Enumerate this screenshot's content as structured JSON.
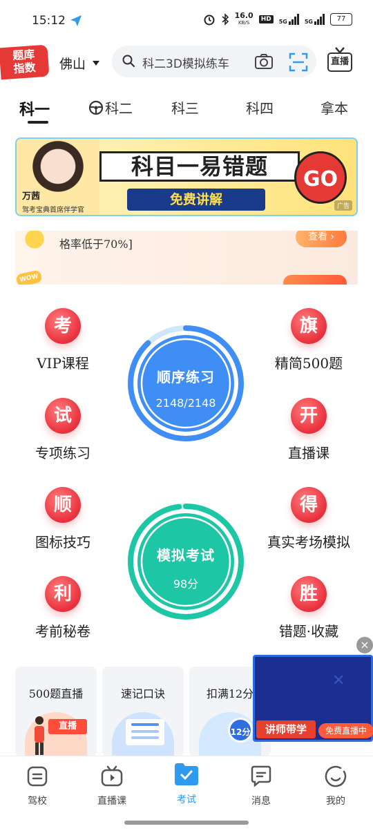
{
  "status": {
    "time": "15:12",
    "network_speed": "16.0",
    "network_unit": "KB/S",
    "hd_badge": "HD",
    "sig1": "5G",
    "sig2": "5G",
    "battery": "77"
  },
  "header": {
    "logo_line1": "题库",
    "logo_line2": "指数",
    "city": "佛山",
    "search_placeholder": "科二3D模拟练车",
    "tv_label": "直播"
  },
  "tabs": [
    {
      "label": "科一",
      "active": true
    },
    {
      "label": "科二",
      "active": false
    },
    {
      "label": "科三",
      "active": false
    },
    {
      "label": "科四",
      "active": false
    },
    {
      "label": "拿本",
      "active": false
    }
  ],
  "banner": {
    "headline": "科目一易错题",
    "subline": "免费讲解",
    "go": "GO",
    "teacher_name": "万茜",
    "teacher_title": "驾考宝典首席伴学官",
    "ad_tag": "广告"
  },
  "notices": {
    "line1": "格率低于70%]",
    "button1": "查看 ›",
    "wow": "WOW"
  },
  "features": {
    "left": [
      {
        "icon": "考",
        "label": "VIP课程"
      },
      {
        "icon": "试",
        "label": "专项练习"
      },
      {
        "icon": "顺",
        "label": "图标技巧"
      },
      {
        "icon": "利",
        "label": "考前秘卷"
      }
    ],
    "right": [
      {
        "icon": "旗",
        "label": "精简500题"
      },
      {
        "icon": "开",
        "label": "直播课"
      },
      {
        "icon": "得",
        "label": "真实考场模拟"
      },
      {
        "icon": "胜",
        "label": "错题·收藏"
      }
    ]
  },
  "practice": {
    "title": "顺序练习",
    "value": "2148/2148",
    "progress": 0.88,
    "color": "#3f8ef5"
  },
  "exam": {
    "title": "模拟考试",
    "value": "98分",
    "progress": 0.98,
    "color": "#1dc6a4"
  },
  "cards": [
    {
      "title": "500题直播",
      "art_label": "直播"
    },
    {
      "title": "速记口诀",
      "art_label": ""
    },
    {
      "title": "扣满12分",
      "art_label": "12分"
    }
  ],
  "floating_live": {
    "tag1": "讲师带学",
    "tag2": "免费直播中"
  },
  "tabbar": [
    {
      "label": "驾校",
      "active": false
    },
    {
      "label": "直播课",
      "active": false
    },
    {
      "label": "考试",
      "active": true
    },
    {
      "label": "消息",
      "active": false
    },
    {
      "label": "我的",
      "active": false
    }
  ]
}
